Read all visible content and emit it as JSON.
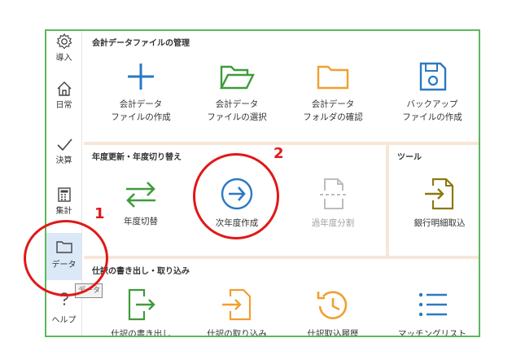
{
  "sidebar": {
    "items": [
      {
        "label": "導入",
        "icon": "gear-icon"
      },
      {
        "label": "日常",
        "icon": "home-icon"
      },
      {
        "label": "決算",
        "icon": "checkmark-icon"
      },
      {
        "label": "集計",
        "icon": "calculator-icon"
      },
      {
        "label": "データ",
        "icon": "folder-icon",
        "active": true
      },
      {
        "label": "ヘルプ",
        "icon": "help-icon"
      }
    ],
    "tooltip": "データ"
  },
  "sections": {
    "file_management": {
      "title": "会計データファイルの管理",
      "tiles": [
        {
          "line1": "会計データ",
          "line2": "ファイルの作成",
          "icon": "plus-icon",
          "color": "#2b79c2"
        },
        {
          "line1": "会計データ",
          "line2": "ファイルの選択",
          "icon": "open-folder-icon",
          "color": "#3f9b3a"
        },
        {
          "line1": "会計データ",
          "line2": "フォルダの確認",
          "icon": "folder-icon",
          "color": "#f0a030"
        },
        {
          "line1": "バックアップ",
          "line2": "ファイルの作成",
          "icon": "save-disk-icon",
          "color": "#2b79c2"
        }
      ]
    },
    "year_update": {
      "title": "年度更新・年度切り替え",
      "tiles": [
        {
          "label": "年度切替",
          "icon": "swap-arrows-icon",
          "color": "#3f9b3a"
        },
        {
          "label": "次年度作成",
          "icon": "circle-arrow-right-icon",
          "color": "#2b79c2"
        },
        {
          "label": "過年度分割",
          "icon": "split-document-icon",
          "color": "#bdbdbd",
          "disabled": true
        }
      ]
    },
    "tools": {
      "title": "ツール",
      "tiles": [
        {
          "label": "銀行明細取込",
          "icon": "import-document-icon",
          "color": "#8a7a10"
        }
      ]
    },
    "journal_io": {
      "title": "仕訳の書き出し・取り込み",
      "tiles": [
        {
          "label": "仕訳の書き出し",
          "icon": "export-document-icon",
          "color": "#3f9b3a"
        },
        {
          "label": "仕訳の取り込み",
          "icon": "import-file-icon",
          "color": "#f0a030"
        },
        {
          "label": "仕訳取込履歴",
          "icon": "history-icon",
          "color": "#f0a030"
        },
        {
          "label": "マッチングリスト",
          "icon": "list-icon",
          "color": "#2b79c2"
        }
      ]
    }
  },
  "annotations": {
    "step1": "1",
    "step2": "2",
    "color": "#e01818"
  }
}
